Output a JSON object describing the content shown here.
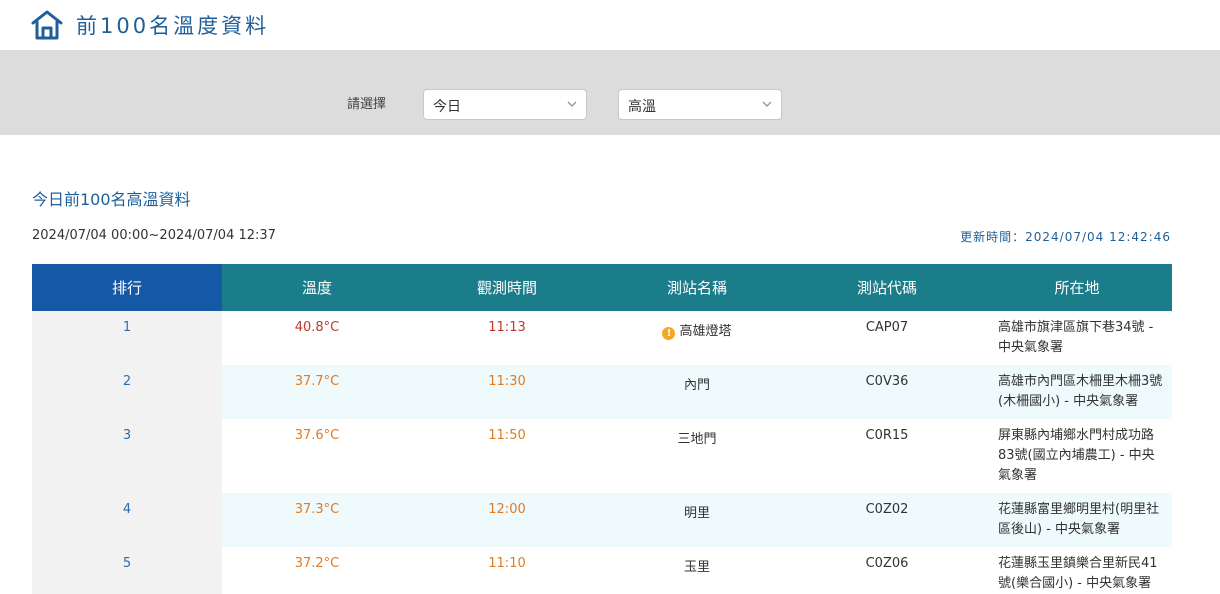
{
  "header": {
    "title": "前100名溫度資料",
    "icon": "home-icon"
  },
  "filter": {
    "label": "請選擇",
    "day_select": "今日",
    "type_select": "高溫"
  },
  "section": {
    "title": "今日前100名高溫資料",
    "range": "2024/07/04 00:00~2024/07/04 12:37",
    "update_label": "更新時間：",
    "update_time": "2024/07/04 12:42:46"
  },
  "table": {
    "headers": [
      "排行",
      "溫度",
      "觀測時間",
      "測站名稱",
      "測站代碼",
      "所在地"
    ],
    "rows": [
      {
        "rank": "1",
        "temp": "40.8°C",
        "time": "11:13",
        "station": "高雄燈塔",
        "code": "CAP07",
        "location": "高雄市旗津區旗下巷34號 - 中央氣象署",
        "warning": true,
        "hot": true
      },
      {
        "rank": "2",
        "temp": "37.7°C",
        "time": "11:30",
        "station": "內門",
        "code": "C0V36",
        "location": "高雄市內門區木柵里木柵3號(木柵國小) - 中央氣象署",
        "warning": false,
        "hot": false
      },
      {
        "rank": "3",
        "temp": "37.6°C",
        "time": "11:50",
        "station": "三地門",
        "code": "C0R15",
        "location": "屏東縣內埔鄉水門村成功路83號(國立內埔農工) - 中央氣象署",
        "warning": false,
        "hot": false
      },
      {
        "rank": "4",
        "temp": "37.3°C",
        "time": "12:00",
        "station": "明里",
        "code": "C0Z02",
        "location": "花蓮縣富里鄉明里村(明里社區後山) - 中央氣象署",
        "warning": false,
        "hot": false
      },
      {
        "rank": "5",
        "temp": "37.2°C",
        "time": "11:10",
        "station": "玉里",
        "code": "C0Z06",
        "location": "花蓮縣玉里鎮樂合里新民41號(樂合國小) - 中央氣象署",
        "warning": false,
        "hot": false
      }
    ]
  }
}
